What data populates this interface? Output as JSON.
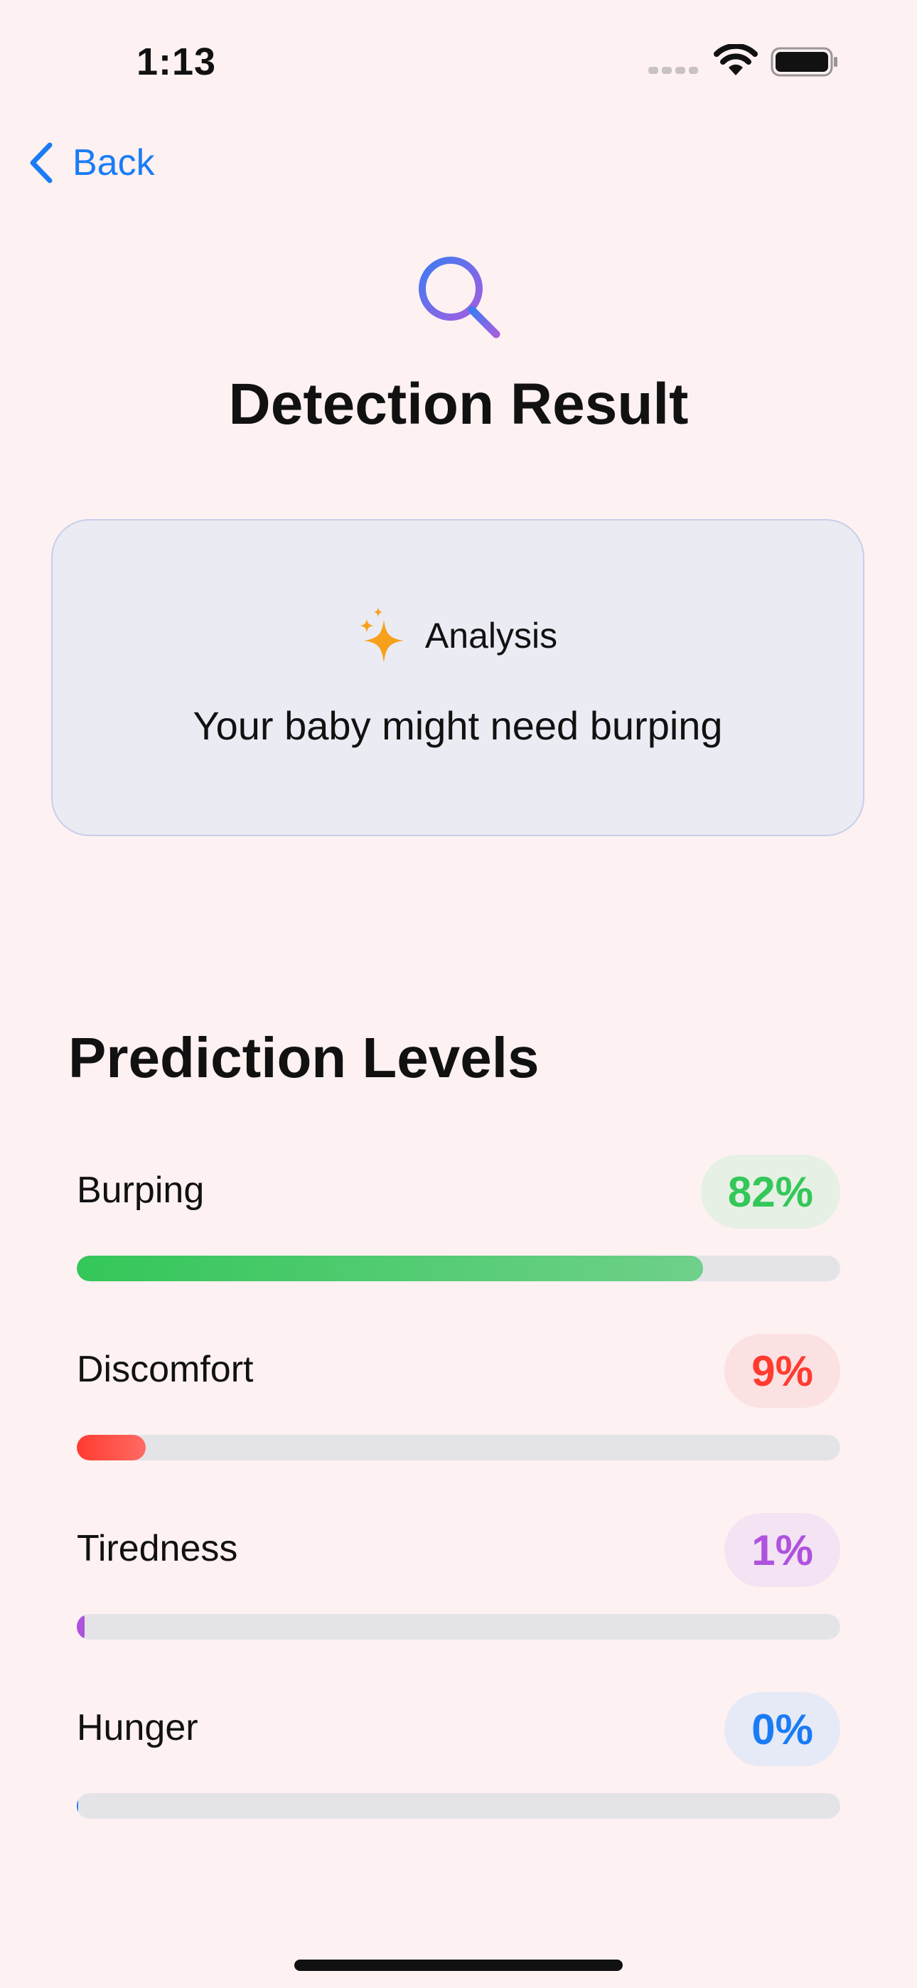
{
  "status_bar": {
    "time": "1:13",
    "signal_icon": "signal-dots-icon",
    "wifi_icon": "wifi-icon",
    "battery_icon": "battery-icon"
  },
  "nav": {
    "back_label": "Back",
    "back_icon": "chevron-left-icon"
  },
  "header": {
    "icon": "magnifying-glass-icon",
    "title": "Detection Result"
  },
  "analysis": {
    "icon": "sparkle-icon",
    "label": "Analysis",
    "message": "Your baby might need burping"
  },
  "predictions": {
    "title": "Prediction Levels",
    "items": [
      {
        "label": "Burping",
        "percent_text": "82%",
        "level": 0.82,
        "color": "#34c759",
        "color_end": "#6fd08a",
        "badge_bg": "#e6f0e4"
      },
      {
        "label": "Discomfort",
        "percent_text": "9%",
        "level": 0.09,
        "color": "#ff3b30",
        "color_end": "#ff6b64",
        "badge_bg": "#fbe1e2"
      },
      {
        "label": "Tiredness",
        "percent_text": "1%",
        "level": 0.01,
        "color": "#af52de",
        "color_end": "#af52de",
        "badge_bg": "#f3e3f3"
      },
      {
        "label": "Hunger",
        "percent_text": "0%",
        "level": 0.0,
        "color": "#1a7cf5",
        "color_end": "#1a7cf5",
        "badge_bg": "#e6e9f6"
      }
    ]
  },
  "colors": {
    "background": "#fdf1f2",
    "accent": "#1a7cf5",
    "card_background": "#eaebf3"
  }
}
